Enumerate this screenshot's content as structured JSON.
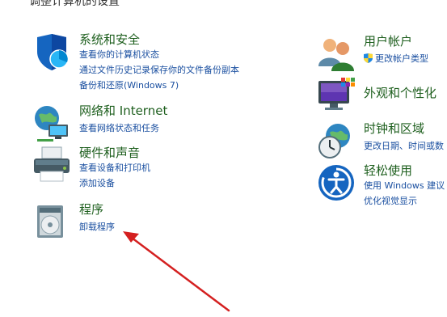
{
  "page_heading": "调整计算机的设置",
  "categories": {
    "system": {
      "title": "系统和安全",
      "links": [
        "查看你的计算机状态",
        "通过文件历史记录保存你的文件备份副本",
        "备份和还原(Windows 7)"
      ]
    },
    "network": {
      "title": "网络和 Internet",
      "links": [
        "查看网络状态和任务"
      ]
    },
    "hardware": {
      "title": "硬件和声音",
      "links": [
        "查看设备和打印机",
        "添加设备"
      ]
    },
    "programs": {
      "title": "程序",
      "links": [
        "卸载程序"
      ]
    },
    "users": {
      "title": "用户帐户",
      "links": [
        "更改帐户类型"
      ]
    },
    "appearance": {
      "title": "外观和个性化",
      "links": []
    },
    "clock": {
      "title": "时钟和区域",
      "links": [
        "更改日期、时间或数"
      ]
    },
    "ease": {
      "title": "轻松使用",
      "links": [
        "使用 Windows 建议",
        "优化视觉显示"
      ]
    }
  },
  "colors": {
    "title_green": "#1e5f1e",
    "link_blue": "#1a4fa0",
    "arrow_red": "#d42020"
  }
}
